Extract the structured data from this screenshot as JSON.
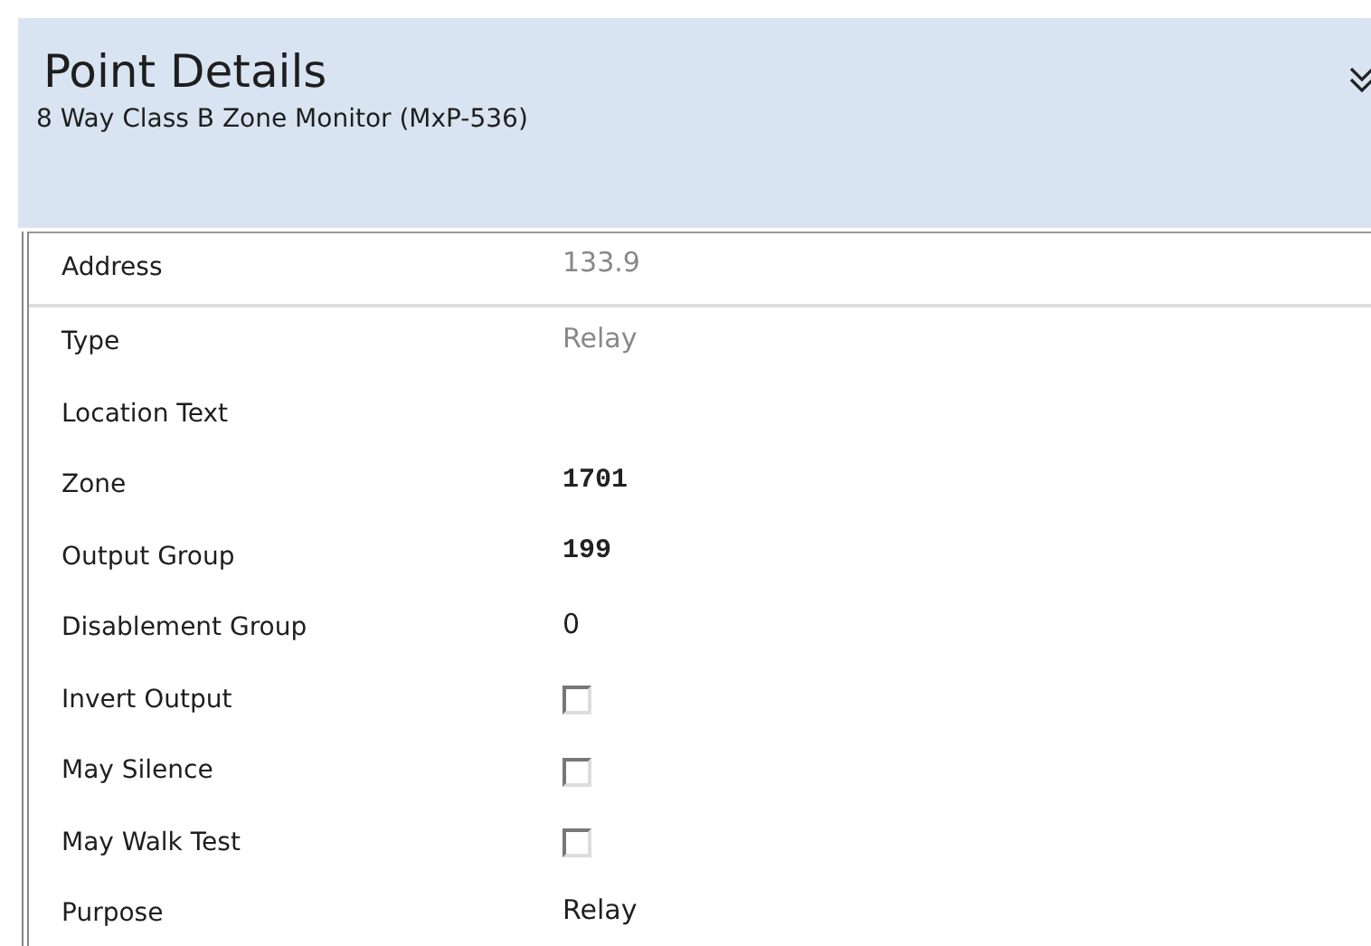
{
  "header": {
    "title": "Point Details",
    "subtitle": "8 Way Class B Zone Monitor (MxP-536)"
  },
  "properties": [
    {
      "label": "Address",
      "kind": "readonly",
      "value": "133.9"
    },
    {
      "label": "Type",
      "kind": "readonly",
      "value": "Relay"
    },
    {
      "label": "Location Text",
      "kind": "text"
    },
    {
      "label": "Zone",
      "kind": "mono",
      "value": "1701"
    },
    {
      "label": "Output Group",
      "kind": "mono",
      "value": "199"
    },
    {
      "label": "Disablement Group",
      "kind": "text",
      "value": "0"
    },
    {
      "label": "Invert Output",
      "kind": "checkbox",
      "checked": false
    },
    {
      "label": "May Silence",
      "kind": "checkbox",
      "checked": false
    },
    {
      "label": "May Walk Test",
      "kind": "checkbox",
      "checked": false
    },
    {
      "label": "Purpose",
      "kind": "text",
      "value": "Relay"
    }
  ]
}
